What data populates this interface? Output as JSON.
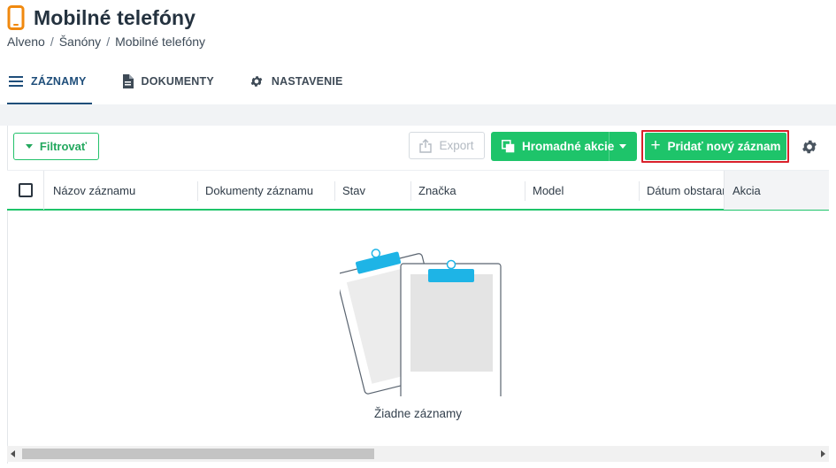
{
  "header": {
    "title": "Mobilné telefóny",
    "icon": "mobile-phone-icon",
    "icon_color": "#f0890f"
  },
  "breadcrumb": [
    "Alveno",
    "Šanóny",
    "Mobilné telefóny"
  ],
  "tabs": [
    {
      "label": "ZÁZNAMY",
      "icon": "list-icon",
      "active": true
    },
    {
      "label": "DOKUMENTY",
      "icon": "document-icon",
      "active": false
    },
    {
      "label": "NASTAVENIE",
      "icon": "gear-icon",
      "active": false
    }
  ],
  "toolbar": {
    "filter_label": "Filtrovať",
    "export_label": "Export",
    "bulk_label": "Hromadné akcie",
    "add_label": "Pridať nový záznam"
  },
  "table": {
    "columns": [
      "Názov záznamu",
      "Dokumenty záznamu",
      "Stav",
      "Značka",
      "Model",
      "Dátum obstarania",
      "Akcia"
    ]
  },
  "empty_state": {
    "text": "Žiadne záznamy"
  },
  "colors": {
    "accent_green": "#1ec46a",
    "highlight_red": "#d9212b",
    "tab_active": "#1f4e7a",
    "clipboard_clip": "#1eb4e6"
  }
}
